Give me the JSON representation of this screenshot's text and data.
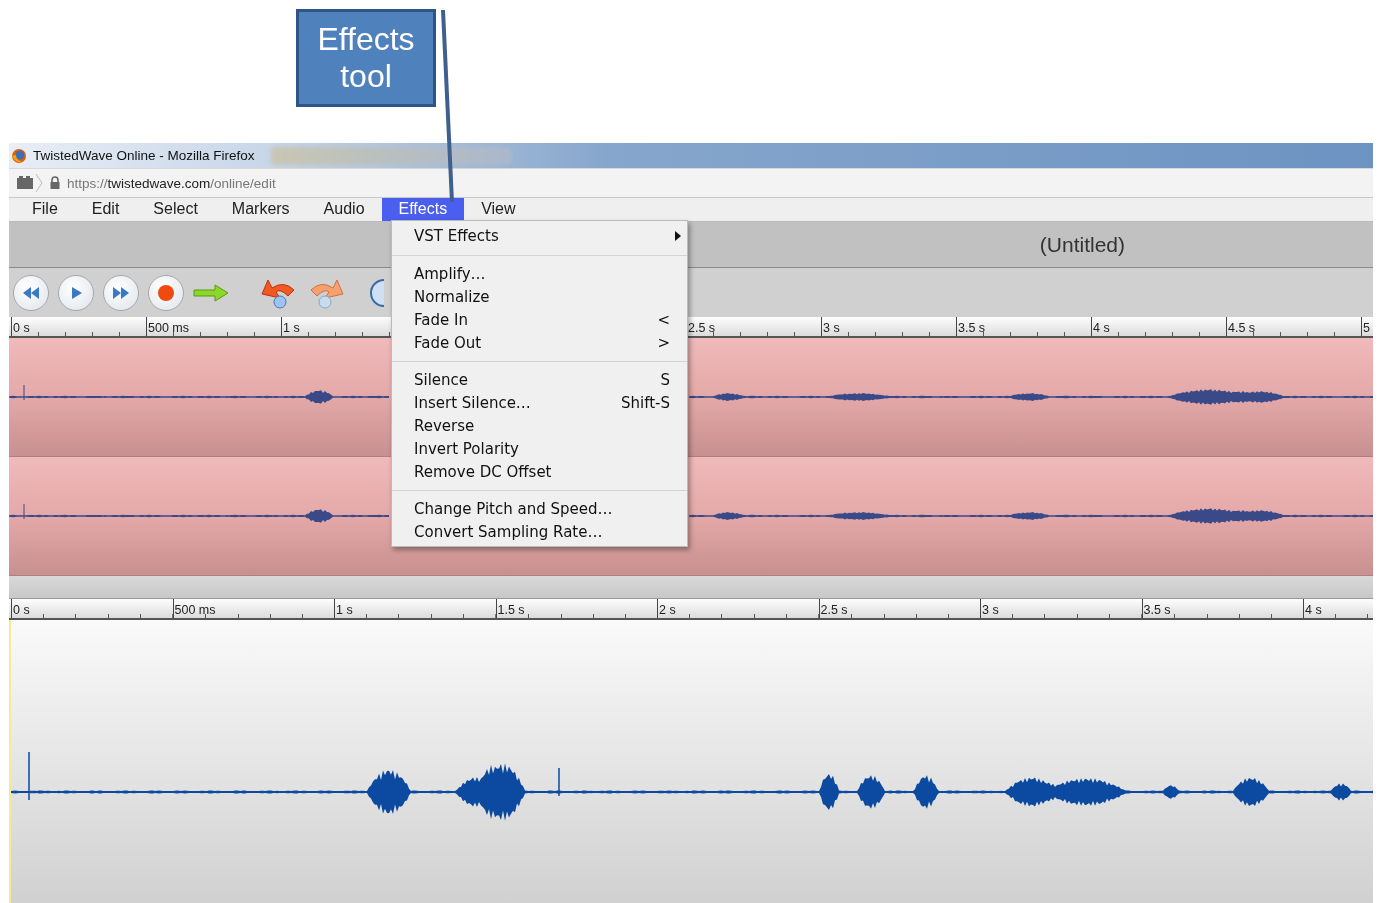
{
  "callout": {
    "text": "Effects tool"
  },
  "window": {
    "title": "TwistedWave Online - Mozilla Firefox",
    "url": "https://**twistedwave.com**/online/edit"
  },
  "menubar": [
    {
      "label": "File",
      "selected": false
    },
    {
      "label": "Edit",
      "selected": false
    },
    {
      "label": "Select",
      "selected": false
    },
    {
      "label": "Markers",
      "selected": false
    },
    {
      "label": "Audio",
      "selected": false
    },
    {
      "label": "Effects",
      "selected": true
    },
    {
      "label": "View",
      "selected": false
    }
  ],
  "effects_menu": [
    {
      "kind": "item",
      "label": "VST Effects",
      "submenu": true
    },
    {
      "kind": "separator"
    },
    {
      "kind": "item",
      "label": "Amplify…"
    },
    {
      "kind": "item",
      "label": "Normalize"
    },
    {
      "kind": "item",
      "label": "Fade In",
      "shortcut": "<"
    },
    {
      "kind": "item",
      "label": "Fade Out",
      "shortcut": ">"
    },
    {
      "kind": "separator"
    },
    {
      "kind": "item",
      "label": "Silence",
      "shortcut": "S"
    },
    {
      "kind": "item",
      "label": "Insert Silence…",
      "shortcut": "Shift-S"
    },
    {
      "kind": "item",
      "label": "Reverse"
    },
    {
      "kind": "item",
      "label": "Invert Polarity"
    },
    {
      "kind": "item",
      "label": "Remove DC Offset"
    },
    {
      "kind": "separator"
    },
    {
      "kind": "item",
      "label": "Change Pitch and Speed…"
    },
    {
      "kind": "item",
      "label": "Convert Sampling Rate…"
    }
  ],
  "document_title": "(Untitled)",
  "overview_ruler": {
    "left": [
      {
        "label": "0 s"
      },
      {
        "label": "500 ms"
      },
      {
        "label": "1 s"
      }
    ],
    "right": [
      {
        "label": "2.5 s"
      },
      {
        "label": "3 s"
      },
      {
        "label": "3.5 s"
      },
      {
        "label": "4 s"
      },
      {
        "label": "4.5 s"
      },
      {
        "label": "5"
      }
    ]
  },
  "detail_ruler": [
    {
      "label": "0 s"
    },
    {
      "label": "500 ms"
    },
    {
      "label": "1 s"
    },
    {
      "label": "1.5 s"
    },
    {
      "label": "2 s"
    },
    {
      "label": "2.5 s"
    },
    {
      "label": "3 s"
    },
    {
      "label": "3.5 s"
    },
    {
      "label": "4 s"
    }
  ]
}
